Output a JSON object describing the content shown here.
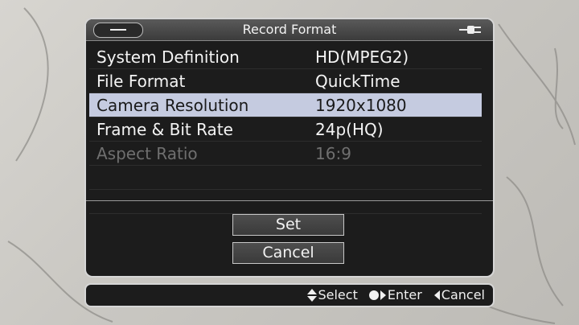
{
  "dialog": {
    "title": "Record Format",
    "rows": [
      {
        "label": "System Definition",
        "value": "HD(MPEG2)",
        "selected": false,
        "disabled": false
      },
      {
        "label": "File Format",
        "value": "QuickTime",
        "selected": false,
        "disabled": false
      },
      {
        "label": "Camera Resolution",
        "value": "1920x1080",
        "selected": true,
        "disabled": false
      },
      {
        "label": "Frame & Bit Rate",
        "value": "24p(HQ)",
        "selected": false,
        "disabled": false
      },
      {
        "label": "Aspect Ratio",
        "value": "16:9",
        "selected": false,
        "disabled": true
      }
    ],
    "set_label": "Set",
    "cancel_label": "Cancel"
  },
  "footer": {
    "select_label": "Select",
    "enter_label": "Enter",
    "cancel_label": "Cancel"
  },
  "colors": {
    "selection": "#c5cbe0",
    "panel": "#1c1c1c",
    "disabled_text": "#6f6f6f"
  },
  "icons": [
    "minus-icon",
    "power-plug-icon",
    "up-down-arrows-icon",
    "dot-right-arrow-icon",
    "left-arrow-icon"
  ]
}
